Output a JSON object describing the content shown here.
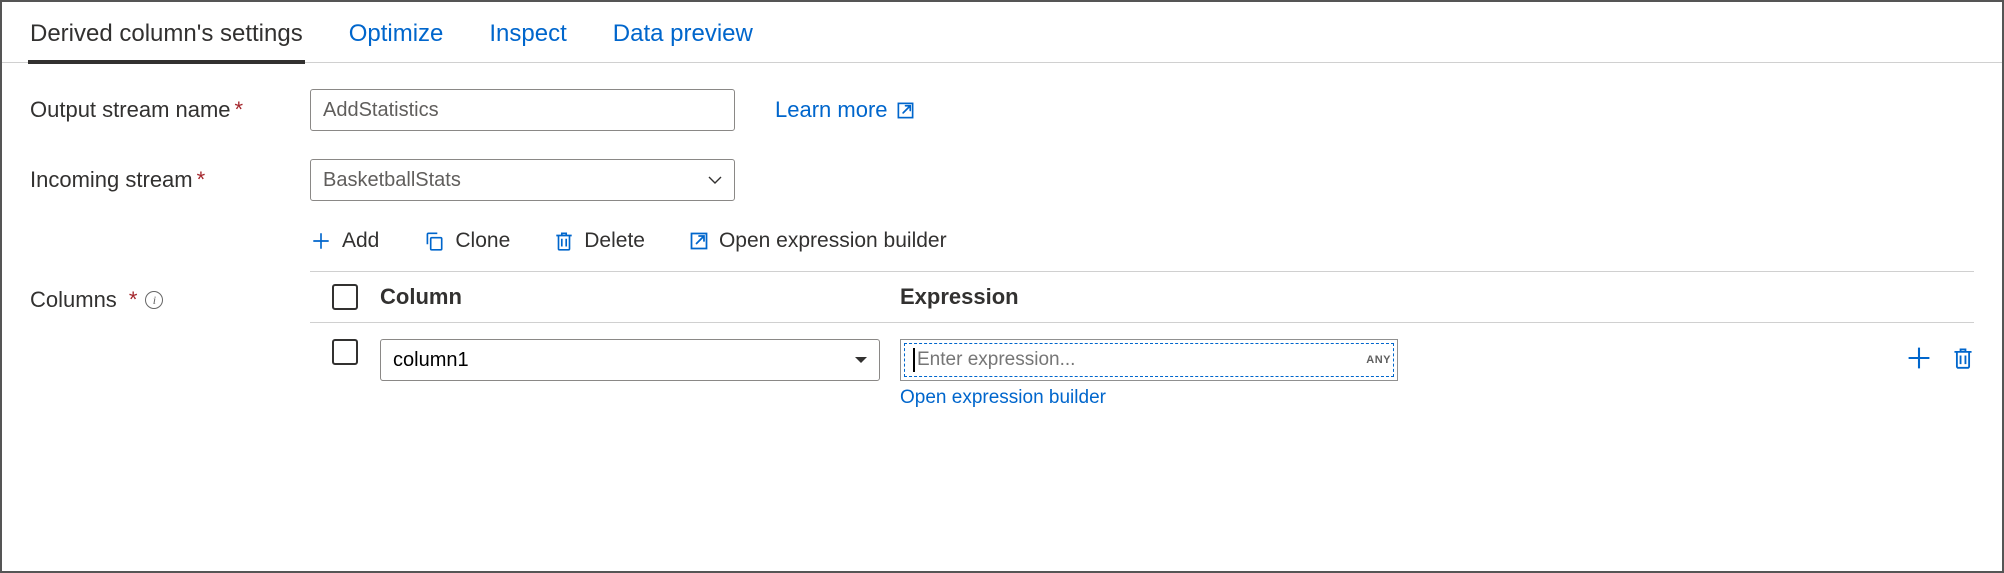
{
  "tabs": {
    "settings": "Derived column's settings",
    "optimize": "Optimize",
    "inspect": "Inspect",
    "preview": "Data preview"
  },
  "labels": {
    "output_stream": "Output stream name",
    "incoming_stream": "Incoming stream",
    "columns": "Columns"
  },
  "fields": {
    "output_stream_value": "AddStatistics",
    "incoming_stream_value": "BasketballStats"
  },
  "links": {
    "learn_more": "Learn more",
    "open_expr_builder": "Open expression builder"
  },
  "toolbar": {
    "add": "Add",
    "clone": "Clone",
    "delete": "Delete",
    "open_builder": "Open expression builder"
  },
  "grid": {
    "header_column": "Column",
    "header_expression": "Expression",
    "rows": [
      {
        "column_name": "column1",
        "expression_placeholder": "Enter expression...",
        "any_badge": "ANY"
      }
    ]
  }
}
